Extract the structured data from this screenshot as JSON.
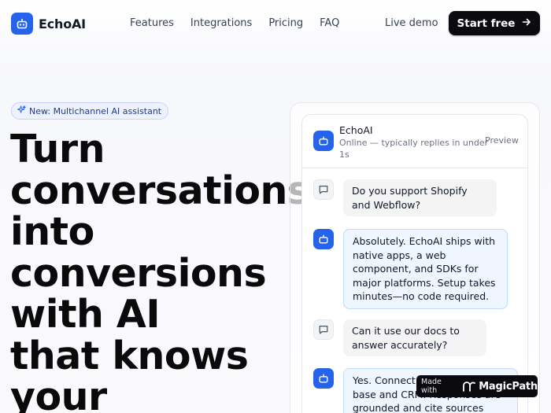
{
  "brand": {
    "name": "EchoAI",
    "logo_icon": "bot-icon",
    "accent": "#2563eb"
  },
  "nav": {
    "links": [
      "Features",
      "Integrations",
      "Pricing",
      "FAQ"
    ],
    "live_demo": "Live demo",
    "cta": "Start free",
    "cta_icon": "arrow-right-icon"
  },
  "hero": {
    "badge_icon": "sparkle-icon",
    "badge": "New: Multichannel AI assistant",
    "headline": "Turn\nconversations\ninto\nconversions\nwith AI\nthat knows\nyour"
  },
  "chat": {
    "title": "EchoAI",
    "status": "Online — typically replies in under 1s",
    "preview": "Preview",
    "messages": [
      {
        "role": "user",
        "icon": "chat-icon",
        "text": "Do you support Shopify and Webflow?"
      },
      {
        "role": "bot",
        "icon": "bot-icon",
        "text": "Absolutely. EchoAI ships with native apps, a web component, and SDKs for major platforms. Setup takes minutes—no code required."
      },
      {
        "role": "user",
        "icon": "chat-icon",
        "text": "Can it use our docs to answer accurately?"
      },
      {
        "role": "bot",
        "icon": "bot-icon",
        "text": "Yes. Connect your knowledge base and CRM. Responses are grounded and cite sources"
      }
    ]
  },
  "badge": {
    "prefix": "Made with",
    "name": "MagicPath"
  }
}
